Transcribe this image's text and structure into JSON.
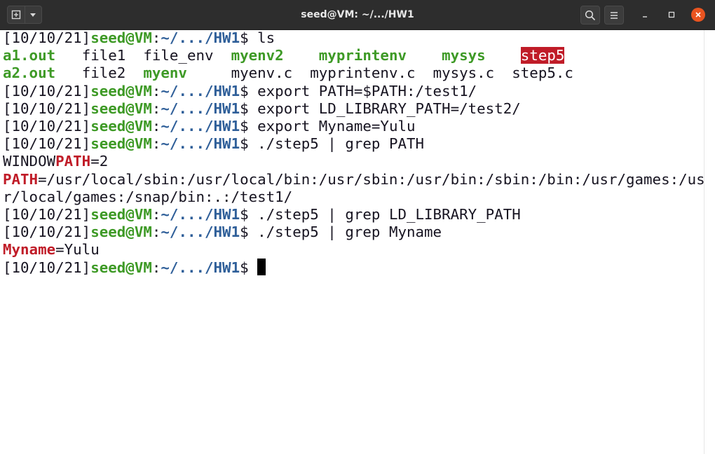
{
  "window": {
    "title": "seed@VM: ~/.../HW1",
    "icons": {
      "new_tab": "new-tab-icon",
      "menu_dropdown": "chevron-down-icon",
      "search": "search-icon",
      "hamburger": "hamburger-menu-icon",
      "minimize": "minimize-icon",
      "maximize": "maximize-icon",
      "close": "close-icon"
    }
  },
  "colors": {
    "prompt_user": "#3e9a26",
    "prompt_path": "#2f5f99",
    "grep_match": "#c01c28",
    "close_button": "#e95420"
  },
  "prompt": {
    "time": "[10/10/21]",
    "user_host": "seed@VM",
    "colon": ":",
    "path": "~/.../HW1",
    "dollar": "$ "
  },
  "commands": {
    "c1": "ls",
    "c2": "export PATH=$PATH:/test1/",
    "c3": "export LD_LIBRARY_PATH=/test2/",
    "c4": "export Myname=Yulu",
    "c5": "./step5 | grep PATH",
    "c6": "./step5 | grep LD_LIBRARY_PATH",
    "c7": "./step5 | grep Myname"
  },
  "ls_output": {
    "row1": [
      "a1.out",
      "file1",
      "file_env",
      "myenv2",
      "myprintenv",
      "mysys",
      "step5"
    ],
    "row2": [
      "a2.out",
      "file2",
      "myenv",
      "myenv.c",
      "myprintenv.c",
      "mysys.c",
      "step5.c"
    ]
  },
  "output": {
    "window_prefix": "WINDOW",
    "path_word": "PATH",
    "window_suffix": "=2",
    "path_line1_rest": "=/usr/local/sbin:/usr/local/bin:/usr/sbin:/usr/bin:/sbin:/bin:/usr/games:/us",
    "path_line2": "r/local/games:/snap/bin:.:/test1/",
    "myname_word": "Myname",
    "myname_rest": "=Yulu"
  }
}
